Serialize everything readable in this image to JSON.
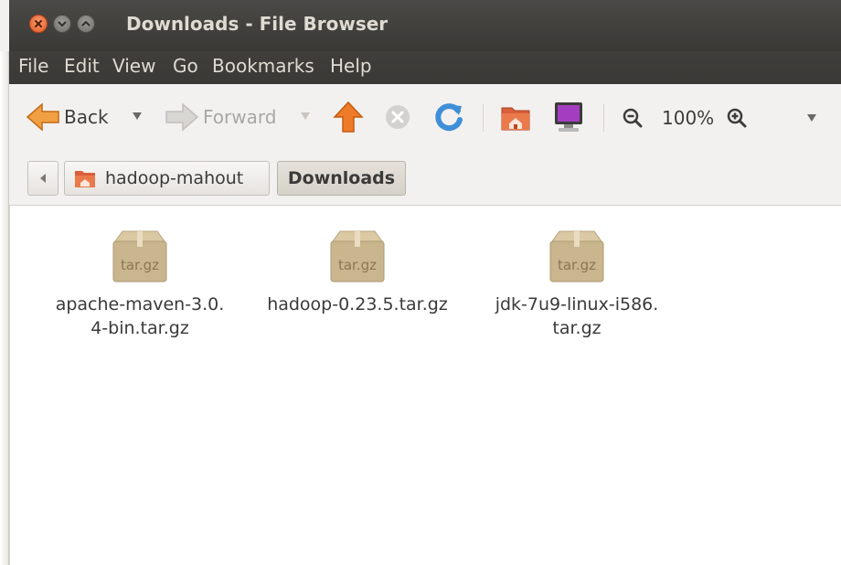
{
  "window": {
    "title": "Downloads - File Browser"
  },
  "menubar": {
    "items": [
      "File",
      "Edit",
      "View",
      "Go",
      "Bookmarks",
      "Help"
    ]
  },
  "toolbar": {
    "back_label": "Back",
    "forward_label": "Forward",
    "zoom_level": "100%",
    "icons": [
      "back-arrow-icon",
      "dropdown-arrow-icon",
      "forward-arrow-icon",
      "up-arrow-icon",
      "stop-icon",
      "reload-icon",
      "home-folder-icon",
      "computer-icon",
      "zoom-out-icon",
      "zoom-in-icon"
    ]
  },
  "pathbar": {
    "crumbs": [
      "hadoop-mahout",
      "Downloads"
    ],
    "active": "Downloads"
  },
  "files": [
    {
      "name": "apache-maven-3.0.\n4-bin.tar.gz",
      "type_label": "tar.gz"
    },
    {
      "name": "hadoop-0.23.5.tar.gz",
      "type_label": "tar.gz"
    },
    {
      "name": "jdk-7u9-linux-i586.\ntar.gz",
      "type_label": "tar.gz"
    }
  ],
  "colors": {
    "titlebar": "#3c3b37",
    "close_button": "#e9622b",
    "archive_box": "#c9b58e",
    "up_arrow": "#ee7b2a",
    "reload": "#3e8fd8"
  }
}
